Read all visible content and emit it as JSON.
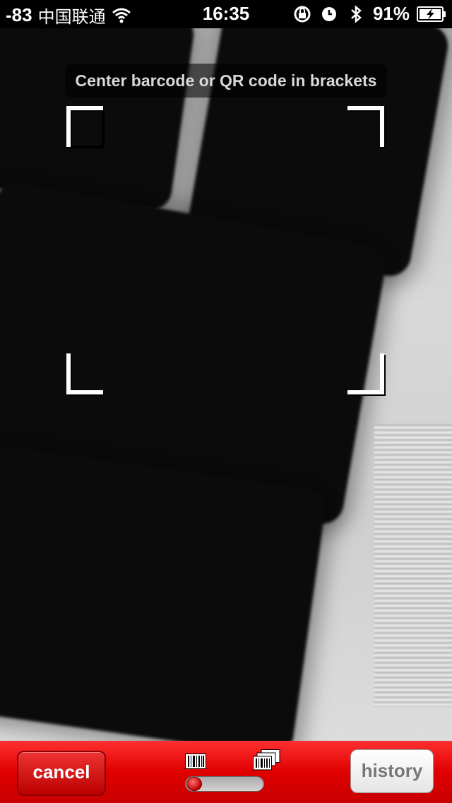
{
  "status_bar": {
    "signal": "-83",
    "carrier": "中国联通",
    "time": "16:35",
    "battery": "91%",
    "icons": [
      "wifi-icon",
      "rotation-lock-icon",
      "alarm-clock-icon",
      "bluetooth-icon",
      "battery-charging-icon"
    ]
  },
  "scanner": {
    "hint": "Center barcode or QR code in brackets"
  },
  "toolbar": {
    "cancel_label": "cancel",
    "history_label": "history",
    "scan_mode": "single",
    "icons": [
      "single-barcode-icon",
      "multi-barcode-icon"
    ]
  },
  "colors": {
    "toolbar": "#e00000",
    "cancel_button": "#cc0000",
    "history_button": "#f0f0f0"
  }
}
